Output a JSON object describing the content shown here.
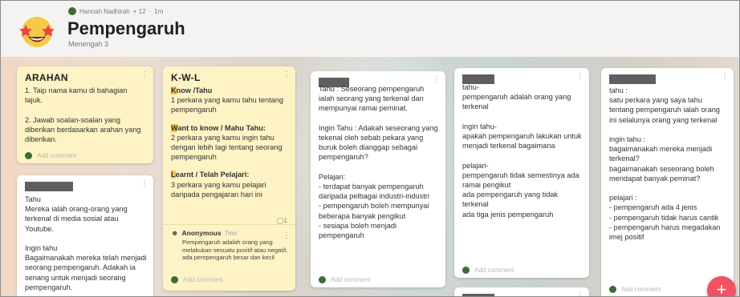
{
  "header": {
    "author": "Hannah Nadhirah",
    "likes": "+ 12",
    "time_sep": "·",
    "time": "1m",
    "title": "Pempengaruh",
    "subtitle": "Menengah 3"
  },
  "cards": {
    "arahan": {
      "title": "ARAHAN",
      "body": "1. Taip nama kamu di bahagian tajuk.\n\n2. Jawab soalan-soalan yang diberikan berdasarkan arahan yang diberikan.",
      "add_comment": "Add comment"
    },
    "kwl": {
      "title": "K-W-L",
      "know_head": "Know /Tahu",
      "know_body": "1 perkara yang kamu tahu tentang pempengaruh",
      "want_head": "Want to know / Mahu Tahu:",
      "want_body": "2 perkara yang kamu ingin tahu dengan lebih lagi tentang seorang pempengaruh",
      "learnt_head": "Learnt / Telah Pelajari:",
      "learnt_body": "3 perkara yang kamu pelajari daripada pengajaran hari ini",
      "comment_count": "1",
      "comment_author": "Anonymous",
      "comment_time": "7mo",
      "comment_text": "Pempengaruh adalah orang yang melakukan sesuatu positif atau negatif, ada pempengaruh besar dan kecil",
      "add_comment": "Add comment"
    },
    "col1_card2": {
      "body": "Tahu\nMereka ialah orang-orang yang terkenal di media sosial atau Youtube.\n\nIngin tahu\nBagaimanakah mereka telah menjadi seorang pempengaruh. Adakah ia senang untuk menjadi seorang pempengaruh."
    },
    "col3": {
      "body": "Tahu : Seseorang pempengaruh ialah seorang yang terkenal dan mempunyai ramai peminat.\n\nIngin Tahu : Adakah seseorang yang tekenal oleh sebab pekara yang buruk boleh dianggap sebagai pempengaruh?\n\nPelajari:\n- terdapat banyak pempengaruh daripada pelbagai industri-industri\n- pempengaruh boleh mempunyai beberapa banyak pengikut\n- sesiapa boleh menjadi pempengaruh",
      "add_comment": "Add comment"
    },
    "col4": {
      "body": "tahu-\npempengaruh adalah orang yang terkenal\n\ningin tahu-\napakah pempengaruh lakukan untuk menjadi terkenal bagaimana\n\npelajari-\npempengaruh tidak semestinya ada ramai pengikut\nada pempengaruh yang tidak terkenal\nada tiga jenis pempengaruh",
      "add_comment": "Add comment"
    },
    "col5": {
      "body": "tahu :\nsatu perkara yang saya tahu tentang pempengaruh ialah orang ini selalunya orang yang terkenal\n\ningin tahu :\nbagaimanakah mereka menjadi terkenal?\nbagaimanakah seseorang boleh mendapat banyak peminat?\n\npelajari :\n- pempengaruh ada 4 jenis\n- pempengaruh tidak harus cantik\n- pempengaruh harus megadakan imej positif",
      "add_comment": "Add comment"
    }
  },
  "fab_label": "+",
  "colors": {
    "yellow_card": "#fdf3c4",
    "fab": "#f25262",
    "highlight": "#f5c542"
  }
}
